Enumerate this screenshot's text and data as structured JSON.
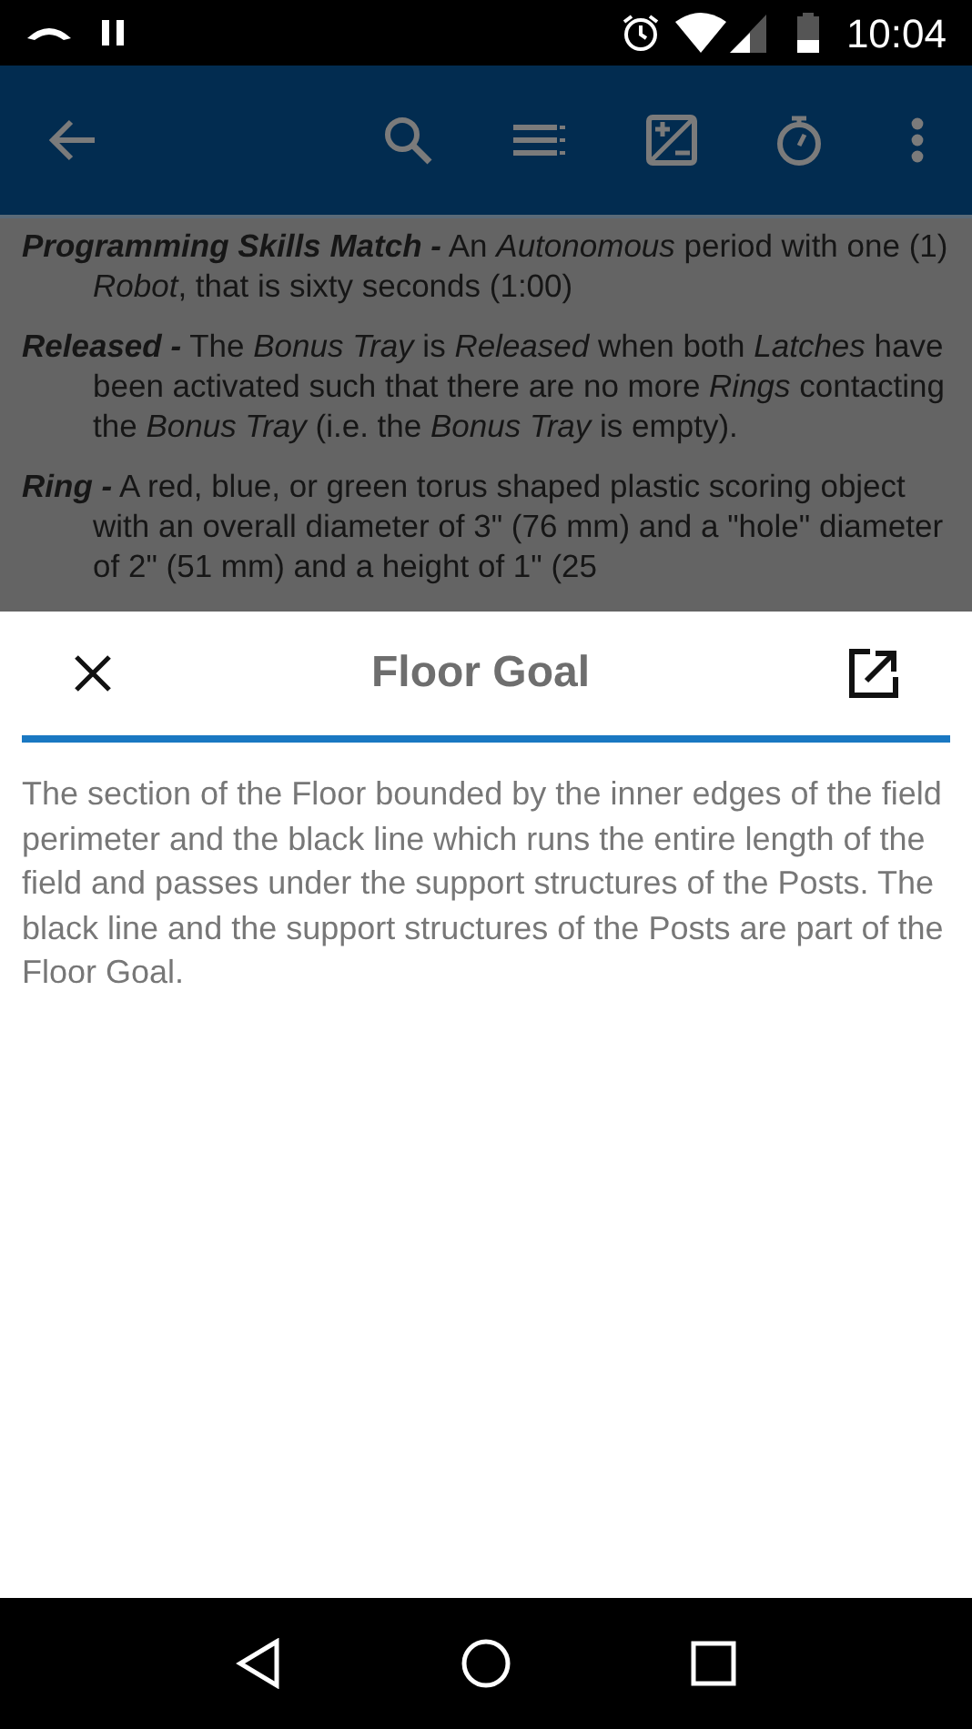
{
  "status_bar": {
    "time": "10:04"
  },
  "definitions": [
    {
      "term": "Programming Skills Match -",
      "body": "An *Autonomous* period with one (1) *Robot*, that is sixty seconds (1:00)"
    },
    {
      "term": "Released -",
      "body": "The *Bonus Tray* is *Released* when both *Latches* have been activated such that there are no more *Rings* contacting the *Bonus Tray* (i.e. the *Bonus Tray* is empty)."
    },
    {
      "term": "Ring -",
      "body": "A red, blue, or green torus shaped plastic scoring object with an overall diameter of 3\" (76 mm) and a \"hole\" diameter of 2\" (51 mm) and a height of 1\" (25"
    }
  ],
  "sheet": {
    "title": "Floor Goal",
    "text": "The section of the Floor bounded by the inner edges of the field perimeter and the black line which runs the entire length of the field and passes under the support structures of the Posts. The black line and the support structures of the Posts are part of the Floor Goal."
  }
}
